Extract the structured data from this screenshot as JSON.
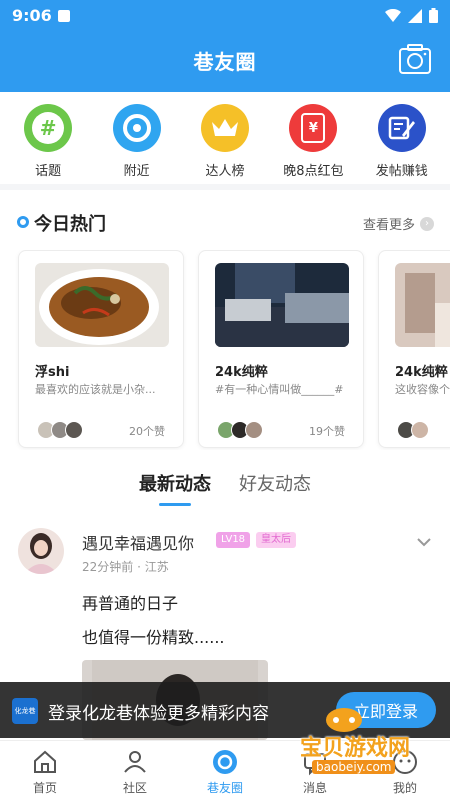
{
  "status_bar": {
    "time": "9:06"
  },
  "header": {
    "title": "巷友圈",
    "camera_icon": "camera-icon",
    "background": "#2f9bf0"
  },
  "quick_nav": [
    {
      "label": "话题",
      "icon": "hashtag-icon",
      "color": "#6cc74a"
    },
    {
      "label": "附近",
      "icon": "location-icon",
      "color": "#2fa5f0"
    },
    {
      "label": "达人榜",
      "icon": "crown-icon",
      "color": "#f5c028"
    },
    {
      "label": "晚8点红包",
      "icon": "red-packet-icon",
      "color": "#ee3b3b"
    },
    {
      "label": "发帖赚钱",
      "icon": "edit-post-icon",
      "color": "#2b52c9"
    }
  ],
  "hot": {
    "title": "今日热门",
    "see_more": "查看更多",
    "cards": [
      {
        "title": "浮shi",
        "desc": "最喜欢的应该就是小杂...",
        "likes": "20个赞"
      },
      {
        "title": "24k纯粹",
        "desc": "#有一种心情叫做______#",
        "likes": "19个赞"
      },
      {
        "title": "24k纯粹",
        "desc": "这收容像个",
        "likes": ""
      }
    ]
  },
  "feed_tabs": [
    {
      "label": "最新动态",
      "active": true
    },
    {
      "label": "好友动态",
      "active": false
    }
  ],
  "post": {
    "name": "遇见幸福遇见你",
    "level": "LV18",
    "badge": "皇太后",
    "meta": "22分钟前 · 江苏",
    "line1": "再普通的日子",
    "line2": "也值得一份精致......"
  },
  "login_banner": {
    "logo": "化龙巷",
    "text": "登录化龙巷体验更多精彩内容",
    "button": "立即登录"
  },
  "tab_bar": [
    {
      "label": "首页",
      "icon": "home-icon"
    },
    {
      "label": "社区",
      "icon": "community-icon"
    },
    {
      "label": "巷友圈",
      "icon": "circle-icon",
      "active": true
    },
    {
      "label": "消息",
      "icon": "message-icon"
    },
    {
      "label": "我的",
      "icon": "profile-icon"
    }
  ],
  "watermark": {
    "text": "宝贝游戏网",
    "url": "baobeiy.com"
  }
}
